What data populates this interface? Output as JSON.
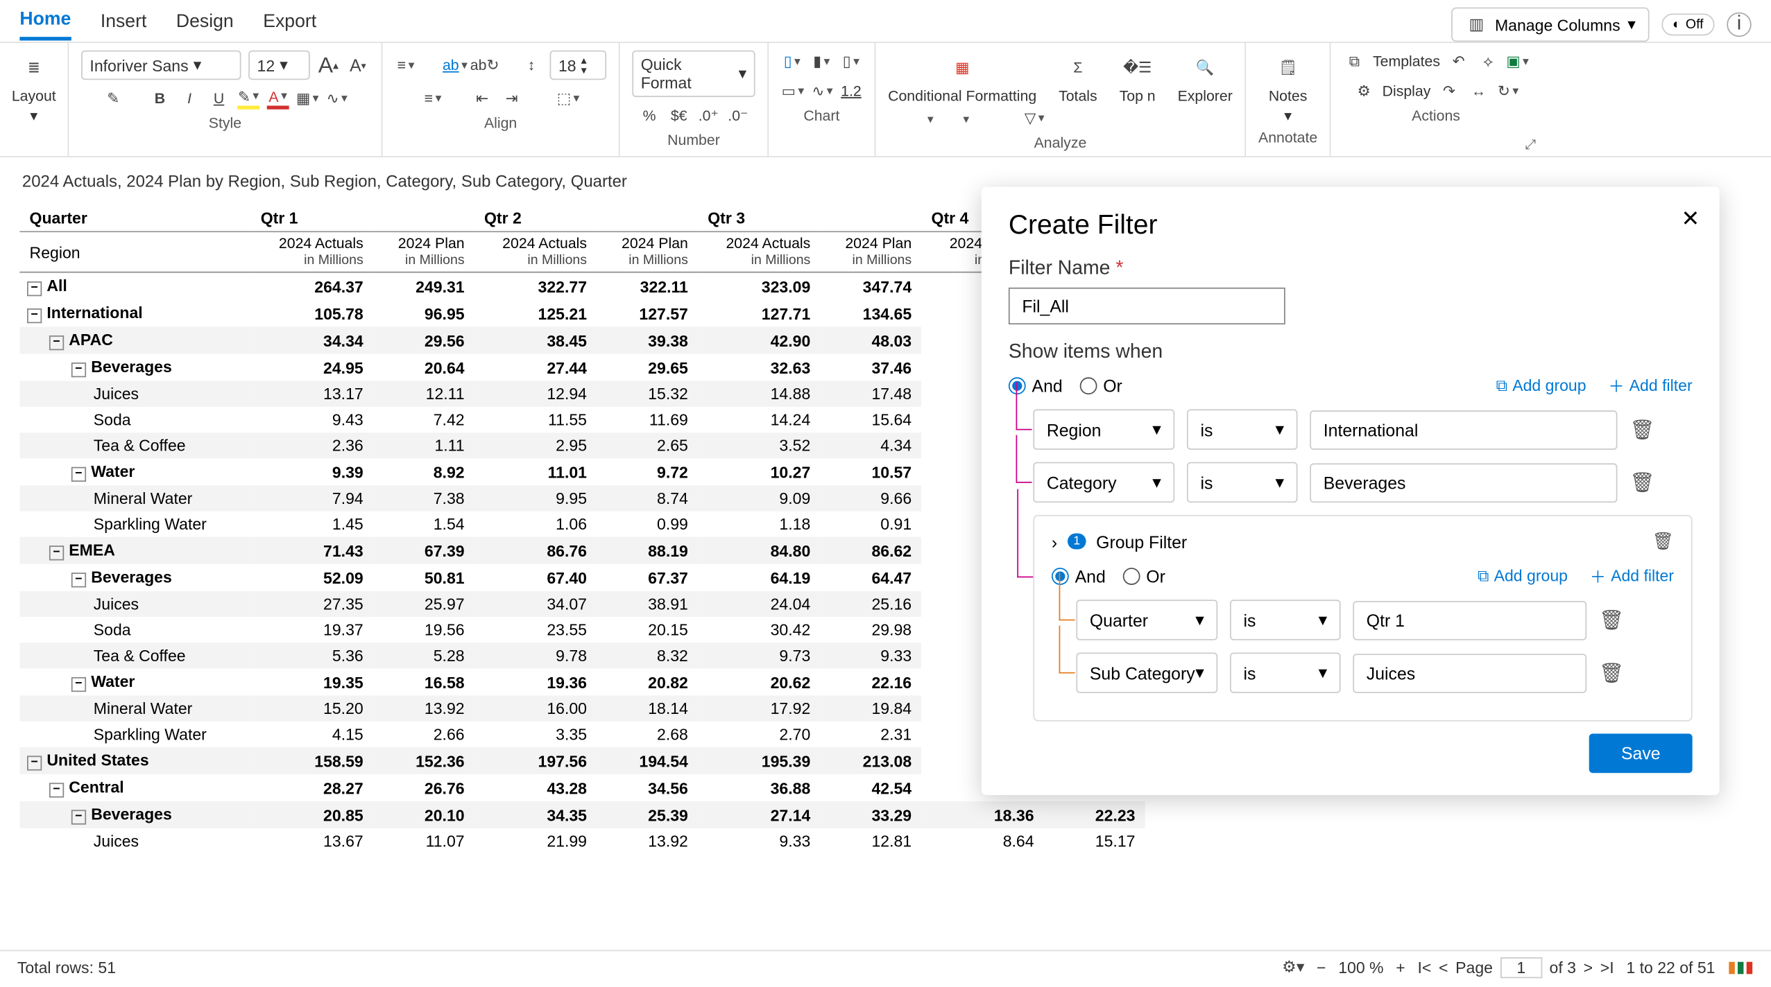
{
  "tabs": {
    "home": "Home",
    "insert": "Insert",
    "design": "Design",
    "export": "Export"
  },
  "toolbar": {
    "manageColumns": "Manage Columns",
    "toggle": "Off"
  },
  "ribbon": {
    "layout": "Layout",
    "font": "Inforiver Sans",
    "fontSize": "12",
    "rowHeight": "18",
    "quickFormat": "Quick Format",
    "cf": "Conditional Formatting",
    "totals": "Totals",
    "topn": "Top n",
    "explorer": "Explorer",
    "notes": "Notes",
    "templates": "Templates",
    "display": "Display",
    "groups": {
      "style": "Style",
      "align": "Align",
      "number": "Number",
      "chart": "Chart",
      "analyze": "Analyze",
      "annotate": "Annotate",
      "actions": "Actions"
    },
    "numfmt": "1.2"
  },
  "sheetTitle": "2024 Actuals, 2024 Plan by Region, Sub Region, Category, Sub Category, Quarter",
  "table": {
    "quarterLabel": "Quarter",
    "regionLabel": "Region",
    "quarters": [
      "Qtr 1",
      "Qtr 2",
      "Qtr 3",
      "Qtr 4"
    ],
    "measures": [
      {
        "name": "2024 Actuals",
        "sub": "in Millions"
      },
      {
        "name": "2024 Plan",
        "sub": "in Millions"
      }
    ],
    "rows": [
      {
        "label": "All",
        "level": 0,
        "bold": true,
        "vals": [
          "264.37",
          "249.31",
          "322.77",
          "322.11",
          "323.09",
          "347.74"
        ]
      },
      {
        "label": "International",
        "level": 0,
        "bold": true,
        "vals": [
          "105.78",
          "96.95",
          "125.21",
          "127.57",
          "127.71",
          "134.65"
        ]
      },
      {
        "label": "APAC",
        "level": 1,
        "bold": true,
        "shade": true,
        "vals": [
          "34.34",
          "29.56",
          "38.45",
          "39.38",
          "42.90",
          "48.03"
        ]
      },
      {
        "label": "Beverages",
        "level": 2,
        "bold": true,
        "vals": [
          "24.95",
          "20.64",
          "27.44",
          "29.65",
          "32.63",
          "37.46"
        ]
      },
      {
        "label": "Juices",
        "level": 3,
        "shade": true,
        "vals": [
          "13.17",
          "12.11",
          "12.94",
          "15.32",
          "14.88",
          "17.48"
        ]
      },
      {
        "label": "Soda",
        "level": 3,
        "vals": [
          "9.43",
          "7.42",
          "11.55",
          "11.69",
          "14.24",
          "15.64"
        ]
      },
      {
        "label": "Tea & Coffee",
        "level": 3,
        "shade": true,
        "vals": [
          "2.36",
          "1.11",
          "2.95",
          "2.65",
          "3.52",
          "4.34"
        ]
      },
      {
        "label": "Water",
        "level": 2,
        "bold": true,
        "vals": [
          "9.39",
          "8.92",
          "11.01",
          "9.72",
          "10.27",
          "10.57"
        ]
      },
      {
        "label": "Mineral Water",
        "level": 3,
        "shade": true,
        "vals": [
          "7.94",
          "7.38",
          "9.95",
          "8.74",
          "9.09",
          "9.66"
        ]
      },
      {
        "label": "Sparkling Water",
        "level": 3,
        "vals": [
          "1.45",
          "1.54",
          "1.06",
          "0.99",
          "1.18",
          "0.91"
        ]
      },
      {
        "label": "EMEA",
        "level": 1,
        "bold": true,
        "shade": true,
        "vals": [
          "71.43",
          "67.39",
          "86.76",
          "88.19",
          "84.80",
          "86.62"
        ]
      },
      {
        "label": "Beverages",
        "level": 2,
        "bold": true,
        "vals": [
          "52.09",
          "50.81",
          "67.40",
          "67.37",
          "64.19",
          "64.47"
        ]
      },
      {
        "label": "Juices",
        "level": 3,
        "shade": true,
        "vals": [
          "27.35",
          "25.97",
          "34.07",
          "38.91",
          "24.04",
          "25.16"
        ]
      },
      {
        "label": "Soda",
        "level": 3,
        "vals": [
          "19.37",
          "19.56",
          "23.55",
          "20.15",
          "30.42",
          "29.98"
        ]
      },
      {
        "label": "Tea & Coffee",
        "level": 3,
        "shade": true,
        "vals": [
          "5.36",
          "5.28",
          "9.78",
          "8.32",
          "9.73",
          "9.33"
        ]
      },
      {
        "label": "Water",
        "level": 2,
        "bold": true,
        "vals": [
          "19.35",
          "16.58",
          "19.36",
          "20.82",
          "20.62",
          "22.16"
        ]
      },
      {
        "label": "Mineral Water",
        "level": 3,
        "shade": true,
        "vals": [
          "15.20",
          "13.92",
          "16.00",
          "18.14",
          "17.92",
          "19.84"
        ]
      },
      {
        "label": "Sparkling Water",
        "level": 3,
        "vals": [
          "4.15",
          "2.66",
          "3.35",
          "2.68",
          "2.70",
          "2.31"
        ]
      },
      {
        "label": "United States",
        "level": 0,
        "bold": true,
        "shade": true,
        "vals": [
          "158.59",
          "152.36",
          "197.56",
          "194.54",
          "195.39",
          "213.08"
        ]
      },
      {
        "label": "Central",
        "level": 1,
        "bold": true,
        "vals": [
          "28.27",
          "26.76",
          "43.28",
          "34.56",
          "36.88",
          "42.54"
        ]
      },
      {
        "label": "Beverages",
        "level": 2,
        "bold": true,
        "shade": true,
        "vals": [
          "20.85",
          "20.10",
          "34.35",
          "25.39",
          "27.14",
          "33.29",
          "18.36",
          "22.23"
        ]
      },
      {
        "label": "Juices",
        "level": 3,
        "vals": [
          "13.67",
          "11.07",
          "21.99",
          "13.92",
          "9.33",
          "12.81",
          "8.64",
          "15.17"
        ]
      }
    ]
  },
  "panel": {
    "title": "Create Filter",
    "filterNameLabel": "Filter Name",
    "filterName": "Fil_All",
    "showItems": "Show items when",
    "and": "And",
    "or": "Or",
    "addGroup": "Add group",
    "addFilter": "Add filter",
    "rows": [
      {
        "field": "Region",
        "op": "is",
        "value": "International"
      },
      {
        "field": "Category",
        "op": "is",
        "value": "Beverages"
      }
    ],
    "groupLabel": "Group Filter",
    "groupRows": [
      {
        "field": "Quarter",
        "op": "is",
        "value": "Qtr 1"
      },
      {
        "field": "Sub Category",
        "op": "is",
        "value": "Juices"
      }
    ],
    "save": "Save"
  },
  "footer": {
    "total": "Total rows: 51",
    "zoom": "100 %",
    "pageLabel": "Page",
    "page": "1",
    "ofPages": "of 3",
    "range": "1 to 22 of 51"
  }
}
